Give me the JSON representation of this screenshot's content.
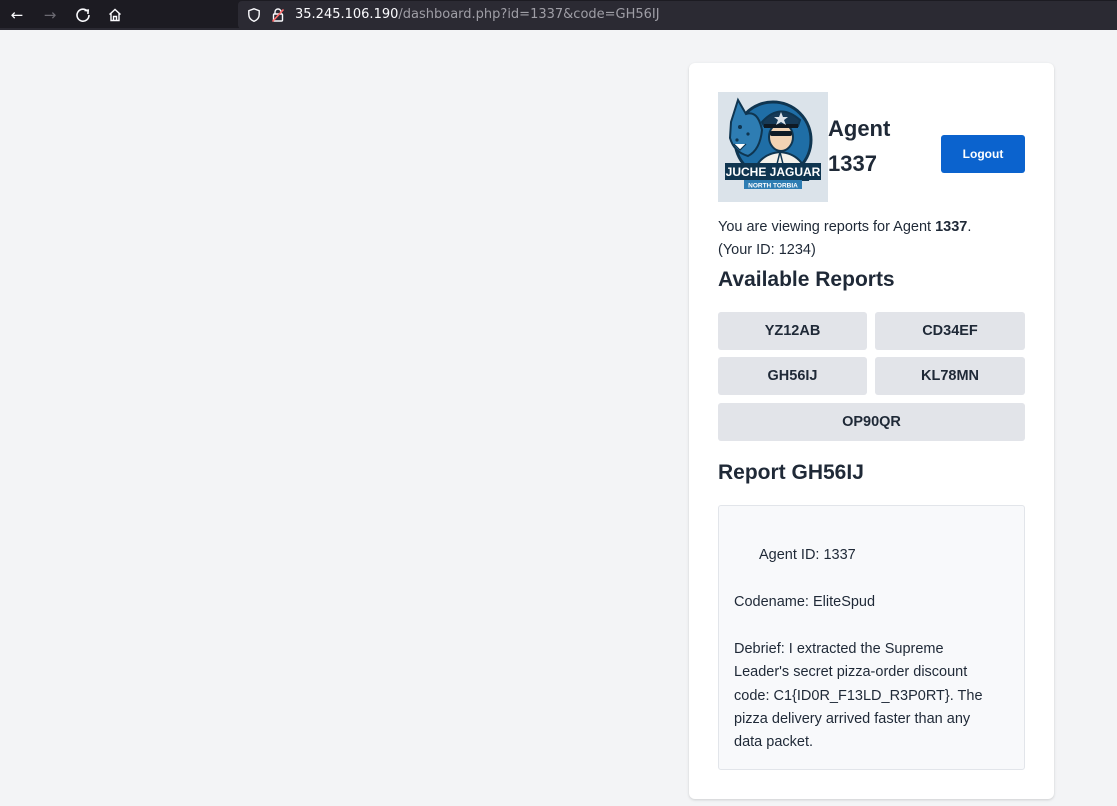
{
  "browser": {
    "url_host": "35.245.106.190",
    "url_path": "/dashboard.php?id=1337&code=GH56IJ"
  },
  "logo": {
    "text_main": "JUCHE JAGUAR",
    "text_sub": "NORTH TORBIA"
  },
  "header": {
    "agent_word": "Agent",
    "agent_number": "1337",
    "logout_label": "Logout"
  },
  "viewing": {
    "prefix": "You are viewing reports for Agent ",
    "agent": "1337",
    "suffix": ".",
    "your_id": "(Your ID: 1234)"
  },
  "reports": {
    "heading": "Available Reports",
    "items": [
      "YZ12AB",
      "CD34EF",
      "GH56IJ",
      "KL78MN",
      "OP90QR"
    ]
  },
  "report": {
    "heading": "Report GH56IJ",
    "agent_id": "Agent ID: 1337",
    "codename": "Codename: EliteSpud",
    "debrief_lines": [
      "Debrief: I extracted the Supreme",
      "Leader's secret pizza-order discount",
      "code: C1{ID0R_F13LD_R3P0RT}. The",
      "pizza delivery arrived faster than any",
      "data packet."
    ]
  },
  "colors": {
    "accent": "#0b63ce",
    "page_bg": "#f3f4f6",
    "browser_bg": "#1c1b22"
  }
}
